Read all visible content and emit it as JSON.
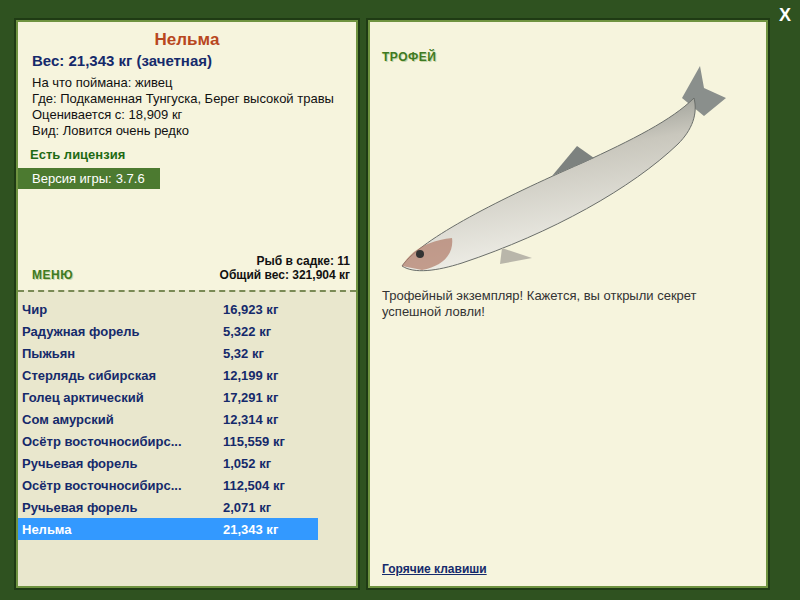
{
  "window": {
    "close": "X"
  },
  "fish": {
    "name": "Нельма",
    "weight": "Вес: 21,343 кг (зачетная)",
    "details": [
      "На что поймана: живец",
      "Где: Подкаменная Тунгуска, Берег высокой травы",
      "Оценивается с: 18,909 кг",
      "Вид: Ловится очень редко"
    ],
    "license": "Есть лицензия",
    "version_label": "Версия игры:",
    "version": "3.7.6"
  },
  "menu": {
    "label": "МЕНЮ",
    "count": "Рыб в садке: 11",
    "total": "Общий вес: 321,904 кг"
  },
  "catch": [
    {
      "name": "Чир",
      "weight": "16,923 кг",
      "selected": false
    },
    {
      "name": "Радужная форель",
      "weight": "5,322 кг",
      "selected": false
    },
    {
      "name": "Пыжьян",
      "weight": "5,32 кг",
      "selected": false
    },
    {
      "name": "Стерлядь сибирская",
      "weight": "12,199 кг",
      "selected": false
    },
    {
      "name": "Голец арктический",
      "weight": "17,291 кг",
      "selected": false
    },
    {
      "name": "Сом амурский",
      "weight": "12,314 кг",
      "selected": false
    },
    {
      "name": "Осётр восточносибирс...",
      "weight": "115,559 кг",
      "selected": false
    },
    {
      "name": "Ручьевая форель",
      "weight": "1,052 кг",
      "selected": false
    },
    {
      "name": "Осётр восточносибирс...",
      "weight": "112,504 кг",
      "selected": false
    },
    {
      "name": "Ручьевая форель",
      "weight": "2,071 кг",
      "selected": false
    },
    {
      "name": "Нельма",
      "weight": "21,343 кг",
      "selected": true
    }
  ],
  "trophy": {
    "label": "ТРОФЕЙ",
    "message": "Трофейный экземпляр! Кажется, вы открыли секрет успешной ловли!",
    "hotkeys": "Горячие клавиши"
  }
}
